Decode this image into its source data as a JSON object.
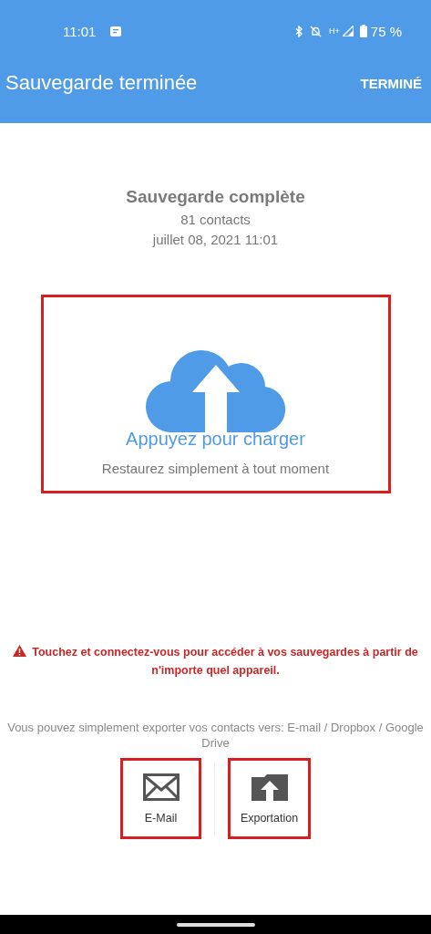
{
  "status_bar": {
    "time": "11:01",
    "network": "H+",
    "battery": "75 %"
  },
  "app_bar": {
    "title": "Sauvegarde terminée",
    "action": "TERMINÉ"
  },
  "summary": {
    "title": "Sauvegarde complète",
    "count": "81 contacts",
    "date": "juillet 08, 2021 11:01"
  },
  "upload": {
    "label": "Appuyez pour charger",
    "hint": "Restaurez simplement à tout moment",
    "highlighted": true
  },
  "warning": "Touchez et connectez-vous pour accéder à vos sauvegardes à partir de n'importe quel appareil.",
  "export_info": "Vous pouvez simplement exporter vos contacts vers: E-mail / Dropbox / Google Drive",
  "export_buttons": [
    {
      "kind": "mail",
      "label": "E-Mail",
      "highlighted": true
    },
    {
      "kind": "export",
      "label": "Exportation",
      "highlighted": true
    }
  ]
}
